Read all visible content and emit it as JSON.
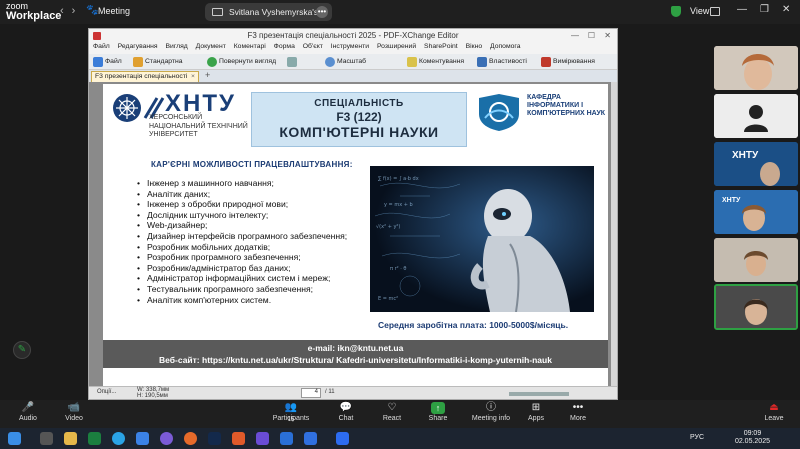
{
  "zoom": {
    "logo_line1": "zoom",
    "logo_line2": "Workplace",
    "meeting_label": "Meeting",
    "screen_share_label": "Svitlana Vyshemyrska's screen",
    "view_label": "View",
    "colors": {
      "bar_bg": "#1f1f1f",
      "shield": "#2ea043",
      "share_green": "#2ea043",
      "leave_red": "#e02828"
    }
  },
  "pdfx": {
    "window_title": "F3 презентація спеціальності 2025 - PDF-XChange Editor",
    "menu": [
      "Файл",
      "Редагування",
      "Вигляд",
      "Документ",
      "Коментарі",
      "Форма",
      "Об'єкт",
      "Інструменти",
      "Розширений",
      "SharePoint",
      "Вікно",
      "Допомога"
    ],
    "toolbar": {
      "file": "Файл",
      "standard": "Стандартна",
      "revert_view": "Повернути вигляд",
      "scale": "Масштаб",
      "commenting": "Коментування",
      "properties": "Властивості",
      "measuring": "Вимірювання"
    },
    "tab_label": "F3 презентація спеціальності 2025",
    "status": {
      "options": "Опції...",
      "width": "W: 338,7мм",
      "height": "H: 190,5мм",
      "page": "4",
      "page_total": "/ 11"
    }
  },
  "slide": {
    "university_abbr": "ХНТУ",
    "university_full": "ХЕРСОНСЬКИЙ НАЦІОНАЛЬНИЙ ТЕХНІЧНИЙ УНІВЕРСИТЕТ",
    "spec_line1": "СПЕЦІАЛЬНІСТЬ",
    "spec_line2": "F3 (122)",
    "spec_line3": "КОМП'ЮТЕРНІ НАУКИ",
    "dept_name": "КАФЕДРА ІНФОРМАТИКИ І КОМП'ЮТЕРНИХ НАУК",
    "career_title": "КАР'ЄРНІ МОЖЛИВОСТІ ПРАЦЕВЛАШТУВАННЯ:",
    "careers": [
      "Інженер з машинного навчання;",
      "Аналітик даних;",
      "Інженер з обробки природної мови;",
      "Дослідник штучного інтелекту;",
      "Web-дизайнер;",
      "Дизайнер інтерфейсів програмного забезпечення;",
      "Розробник мобільних додатків;",
      "Розробник програмного забезпечення;",
      "Розробник/адміністратор баз даних;",
      "Адміністратор інформаційних систем і мереж;",
      "Тестувальник програмного забезпечення;",
      "Аналітик комп'ютерних систем."
    ],
    "salary": "Середня заробітна плата: 1000-5000$/місяць.",
    "email_line": "e-mail: ikn@kntu.net.ua",
    "website_line": "Веб-сайт:  https://kntu.net.ua/ukr/Struktura/ Kafedri-universitetu/Informatiki-i-komp-yuternih-nauk"
  },
  "toolbar": {
    "audio": "Audio",
    "video": "Video",
    "participants": "Participants",
    "participants_count": "15",
    "chat": "Chat",
    "react": "React",
    "share": "Share",
    "meeting_info": "Meeting info",
    "apps": "Apps",
    "more": "More",
    "leave": "Leave"
  },
  "taskbar": {
    "language": "РУС",
    "time": "09:09",
    "date": "02.05.2025"
  }
}
